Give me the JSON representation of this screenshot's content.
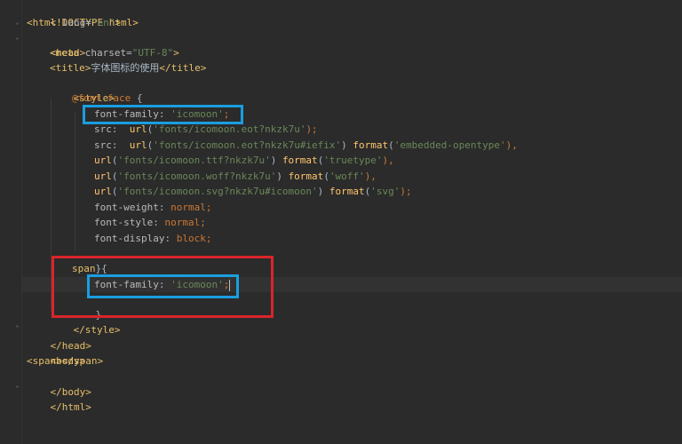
{
  "code": {
    "l1": "<!DOCTYPE html>",
    "l2_open": "<html ",
    "l2_attr": "lang",
    "l2_eq": "=",
    "l2_val": "\"en\"",
    "l2_close": ">",
    "l3": "<head>",
    "l4_open": "<meta ",
    "l4_attr": "charset",
    "l4_eq": "=",
    "l4_val": "\"UTF-8\"",
    "l4_close": ">",
    "l5_open": "<title>",
    "l5_text": "字体图标的使用",
    "l5_close": "</title>",
    "l6": "<style>",
    "l7_at": "@font-face",
    "l7_brace": " {",
    "l8_prop": "font-family",
    "l8_colon": ": ",
    "l8_val": "'icomoon'",
    "l8_semi": ";",
    "l9_prop": "src",
    "l9_colon": ":  ",
    "l9_fn": "url",
    "l9_p1": "(",
    "l9_val": "'fonts/icomoon.eot?nkzk7u'",
    "l9_p2": ");",
    "l10_prop": "src",
    "l10_colon": ":  ",
    "l10_fn": "url",
    "l10_p1": "(",
    "l10_val": "'fonts/icomoon.eot?nkzk7u#iefix'",
    "l10_p2": ") ",
    "l10_fn2": "format",
    "l10_p3": "(",
    "l10_val2": "'embedded-opentype'",
    "l10_p4": "),",
    "l11_fn": "url",
    "l11_p1": "(",
    "l11_val": "'fonts/icomoon.ttf?nkzk7u'",
    "l11_p2": ") ",
    "l11_fn2": "format",
    "l11_p3": "(",
    "l11_val2": "'truetype'",
    "l11_p4": "),",
    "l12_fn": "url",
    "l12_p1": "(",
    "l12_val": "'fonts/icomoon.woff?nkzk7u'",
    "l12_p2": ") ",
    "l12_fn2": "format",
    "l12_p3": "(",
    "l12_val2": "'woff'",
    "l12_p4": "),",
    "l13_fn": "url",
    "l13_p1": "(",
    "l13_val": "'fonts/icomoon.svg?nkzk7u#icomoon'",
    "l13_p2": ") ",
    "l13_fn2": "format",
    "l13_p3": "(",
    "l13_val2": "'svg'",
    "l13_p4": ");",
    "l14_prop": "font-weight",
    "l14_colon": ": ",
    "l14_val": "normal",
    "l14_semi": ";",
    "l15_prop": "font-style",
    "l15_colon": ": ",
    "l15_val": "normal",
    "l15_semi": ";",
    "l16_prop": "font-display",
    "l16_colon": ": ",
    "l16_val": "block",
    "l16_semi": ";",
    "l17": "}",
    "l18_sel": "span",
    "l18_brace": " {",
    "l19_prop": "font-family",
    "l19_colon": ": ",
    "l19_val": "'icomoon'",
    "l19_semi": ";",
    "l20": "}",
    "l21": "</style>",
    "l22": "</head>",
    "l23": "<body>",
    "l24_open": "<span>",
    "l24_text": "",
    "l24_close": "</span>",
    "l25": "</body>",
    "l26": "</html>"
  },
  "colors": {
    "background": "#2b2b2b",
    "tag": "#e8bf6a",
    "string": "#6a8759",
    "keyword": "#cc7832",
    "at_rule": "#bbb529",
    "function": "#ffc66d",
    "highlight_blue": "#1a9ee0",
    "highlight_red": "#d9252b"
  }
}
